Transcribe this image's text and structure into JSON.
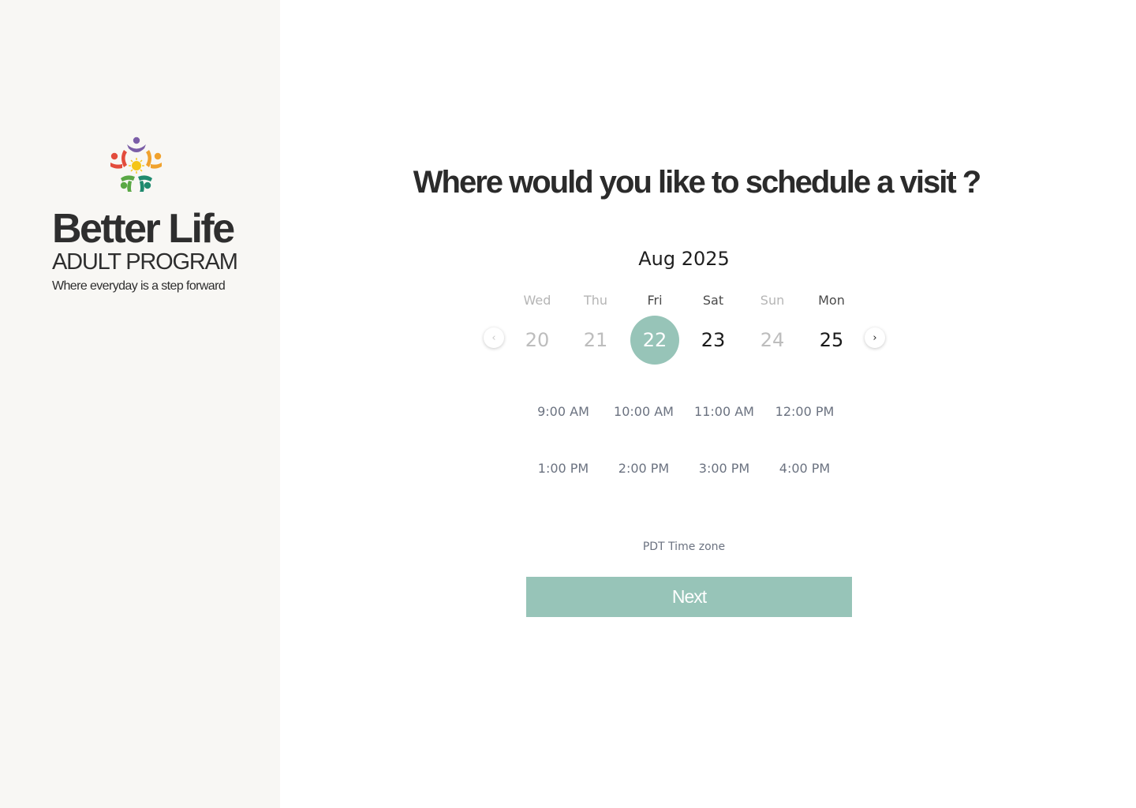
{
  "brand": {
    "title": "Better Life",
    "subtitle": "ADULT PROGRAM",
    "tagline": "Where everyday is a step forward",
    "logo_icon": "people-circle-logo-icon",
    "logo_colors": [
      "#7b5ea7",
      "#f0a22e",
      "#1f8a6e",
      "#5aa845",
      "#e34c3c",
      "#f5c518"
    ]
  },
  "heading": "Where would you like to schedule a visit ?",
  "calendar": {
    "month_label": "Aug 2025",
    "prev_icon": "chevron-left-icon",
    "next_icon": "chevron-right-icon",
    "days": [
      {
        "dow": "Wed",
        "num": "20",
        "state": "disabled"
      },
      {
        "dow": "Thu",
        "num": "21",
        "state": "disabled"
      },
      {
        "dow": "Fri",
        "num": "22",
        "state": "selected"
      },
      {
        "dow": "Sat",
        "num": "23",
        "state": "available"
      },
      {
        "dow": "Sun",
        "num": "24",
        "state": "disabled"
      },
      {
        "dow": "Mon",
        "num": "25",
        "state": "available"
      }
    ],
    "selected_color": "#97c4b8"
  },
  "time_slots": [
    "9:00 AM",
    "10:00 AM",
    "11:00 AM",
    "12:00 PM",
    "1:00 PM",
    "2:00 PM",
    "3:00 PM",
    "4:00 PM"
  ],
  "timezone": "PDT Time zone",
  "next_button": "Next",
  "colors": {
    "accent": "#97c4b8",
    "sidebar_bg": "#f8f7f4",
    "text_dark": "#2b2b2b",
    "text_muted": "#6b7280"
  }
}
